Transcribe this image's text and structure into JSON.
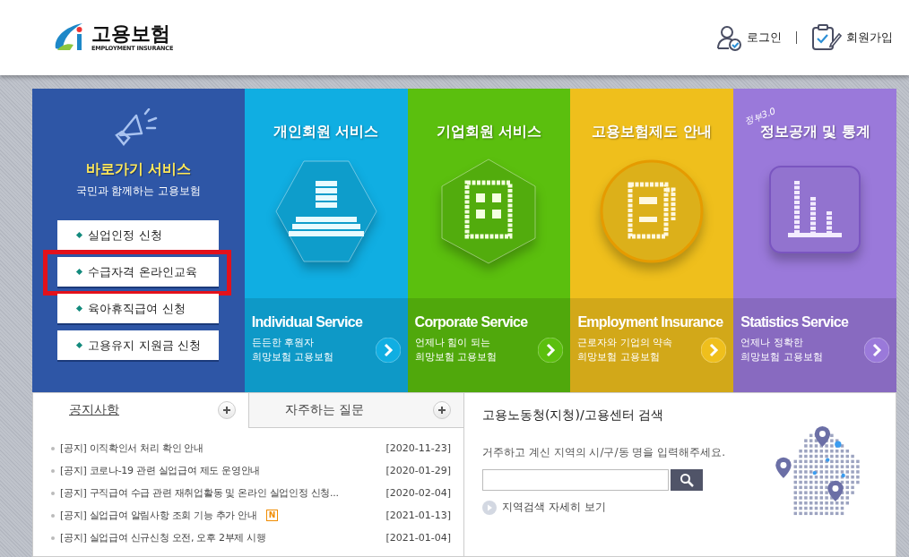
{
  "header": {
    "logo_title": "고용보험",
    "logo_subtitle": "EMPLOYMENT INSURANCE",
    "links": [
      {
        "kind": "login",
        "label": "로그인"
      },
      {
        "kind": "signup",
        "label": "회원가입"
      }
    ]
  },
  "quick": {
    "title": "바로가기 서비스",
    "subtitle": "국민과 함께하는 고용보험",
    "items": [
      {
        "label": "실업인정 신청",
        "highlighted": false
      },
      {
        "label": "수급자격 온라인교육",
        "highlighted": true
      },
      {
        "label": "육아휴직급여 신청",
        "highlighted": false
      },
      {
        "label": "고용유지 지원금 신청",
        "highlighted": false
      }
    ]
  },
  "tiles": [
    {
      "kind": "person",
      "title": "개인회원 서비스",
      "english": "Individual Service",
      "line1": "든든한 후원자",
      "line2": "희망보험 고용보험",
      "color": "#10aee2"
    },
    {
      "kind": "building",
      "title": "기업회원 서비스",
      "english": "Corporate Service",
      "line1": "언제나 힘이 되는",
      "line2": "희망보험 고용보험",
      "color": "#5bbf0e"
    },
    {
      "kind": "document",
      "title": "고용보험제도 안내",
      "english": "Employment Insurance",
      "line1": "근로자와 기업의 약속",
      "line2": "희망보험 고용보험",
      "color": "#efbf1c"
    },
    {
      "kind": "chart",
      "badge": "정부3.0",
      "title": "정보공개 및 통계",
      "english": "Statistics Service",
      "line1": "언제나 정확한",
      "line2": "희망보험 고용보험",
      "color": "#9a79da"
    }
  ],
  "tabs": [
    {
      "label": "공지사항",
      "selected": true
    },
    {
      "label": "자주하는 질문",
      "selected": false
    }
  ],
  "notices": [
    {
      "title": "[공지] 이직확인서 처리 확인 안내",
      "date": "[2020-11-23]"
    },
    {
      "title": "[공지] 코로나-19 관련 실업급여 제도 운영안내",
      "date": "[2020-01-29]"
    },
    {
      "title": "[공지] 구직급여 수급 관련 재취업활동 및 온라인 실업인정 신청...",
      "date": "[2020-02-04]"
    },
    {
      "title": "[공지] 실업급여 알림사항 조회 기능 추가 안내",
      "badge": "N",
      "date": "[2021-01-13]"
    },
    {
      "title": "[공지] 실업급여 신규신청 오전, 오후 2부제 시행",
      "date": "[2021-01-04]"
    }
  ],
  "office_search": {
    "title": "고용노동청(지청)/고용센터 검색",
    "prompt": "거주하고 계신 지역의 시/구/동 명을 입력해주세요.",
    "detail_link": "지역검색 자세히 보기"
  }
}
